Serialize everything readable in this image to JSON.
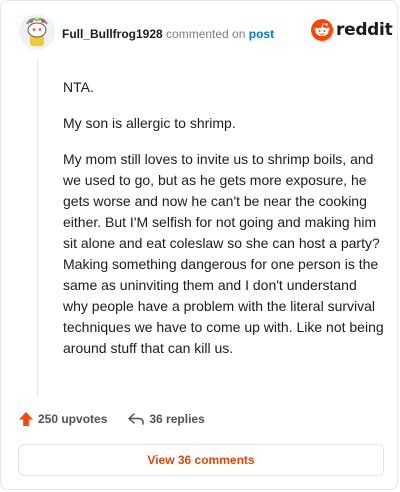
{
  "header": {
    "username": "Full_Bullfrog1928",
    "commented_on": "commented on",
    "post_link": "post",
    "brand": "reddit",
    "brand_color": "#ff4500"
  },
  "comment": {
    "paragraphs": [
      "NTA.",
      "My son is allergic to shrimp.",
      "My mom still loves to invite us to shrimp boils, and we used to go, but as he gets more exposure, he gets worse and now he can't be near the cooking either. But I'M selfish for not going and making him sit alone and eat coleslaw so she can host a party? Making something dangerous for one person is the same as uninviting them and I don't understand why people have a problem with the literal survival techniques we have to come up with. Like not being around stuff that can kill us."
    ]
  },
  "actions": {
    "upvotes": "250 upvotes",
    "upvote_icon": "upvote-arrow-icon",
    "upvote_color": "#ff4500",
    "replies": "36 replies",
    "reply_icon": "reply-arrow-icon"
  },
  "view_button": {
    "label": "View 36 comments",
    "color": "#d94a0e"
  }
}
